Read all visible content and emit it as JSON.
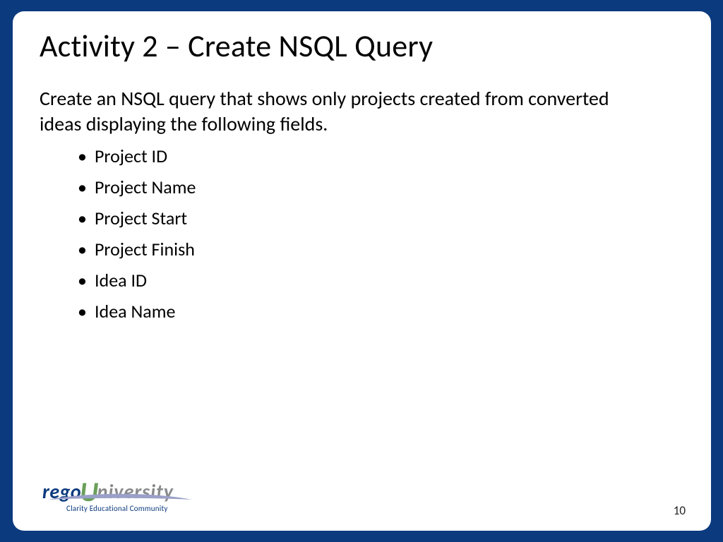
{
  "slide": {
    "title": "Activity 2 – Create NSQL Query",
    "intro": "Create an NSQL query that shows only projects created from converted ideas displaying the following fields.",
    "bullets": [
      "Project ID",
      "Project Name",
      "Project Start",
      "Project Finish",
      "Idea ID",
      "Idea Name"
    ],
    "page_number": "10"
  },
  "logo": {
    "part_rego": "rego",
    "part_U": "U",
    "part_niversity": "niversity",
    "tagline": "Clarity Educational Community"
  },
  "colors": {
    "frame": "#0b3a7e",
    "logo_green": "#6aa05a",
    "logo_gray": "#888a8c"
  }
}
